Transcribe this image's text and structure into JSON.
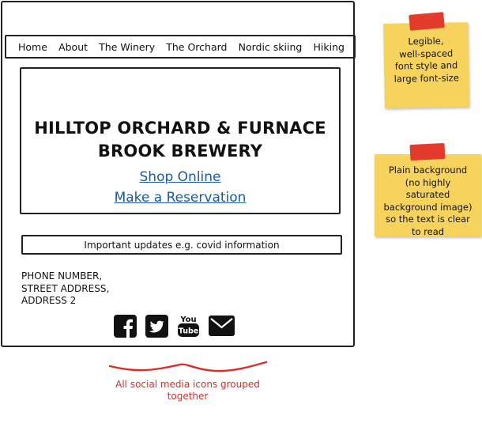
{
  "nav": {
    "items": [
      "Home",
      "About",
      "The Winery",
      "The Orchard",
      "Nordic skiing",
      "Hiking"
    ]
  },
  "hero": {
    "title_line1": "HILLTOP ORCHARD & FURNACE",
    "title_line2": "BROOK BREWERY",
    "shop_link": "Shop Online",
    "reservation_link": "Make a Reservation"
  },
  "updates": {
    "text": "Important updates e.g. covid information"
  },
  "address": {
    "line1": "PHONE NUMBER,",
    "line2": "STREET ADDRESS,",
    "line3": "ADDRESS 2"
  },
  "social": {
    "icons": [
      "facebook-icon",
      "twitter-icon",
      "youtube-icon",
      "email-icon"
    ],
    "youtube_you": "You",
    "youtube_tube": "Tube"
  },
  "annotation": {
    "text": "All social media icons grouped together"
  },
  "notes": {
    "font_note": "Legible,\nwell-spaced\nfont style and\nlarge font-size",
    "background_note": "Plain background\n(no highly\nsaturated\nbackground image)\nso the text is clear\nto read"
  },
  "colors": {
    "link": "#1a5aa6",
    "annotation": "#d6302a",
    "sticky_note": "#f6d35d",
    "tape": "#e33b2c",
    "ink": "#222222"
  }
}
